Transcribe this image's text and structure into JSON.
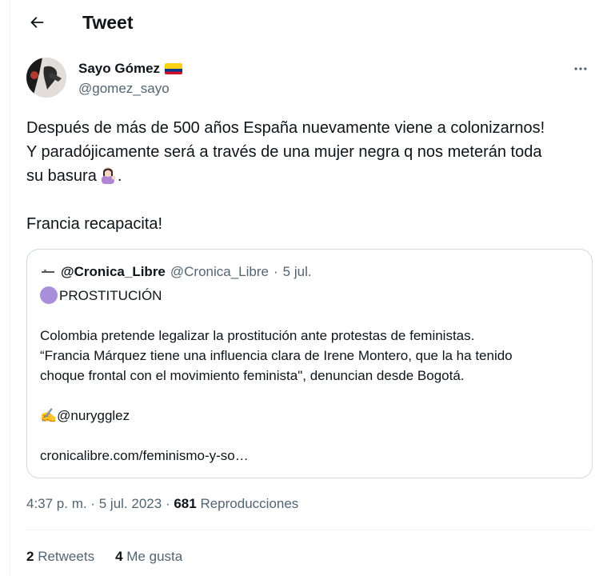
{
  "header": {
    "title": "Tweet"
  },
  "author": {
    "name": "Sayo Gómez",
    "handle": "@gomez_sayo"
  },
  "tweet": {
    "line1": "Después de más de 500 años España nuevamente viene a colonizarnos!",
    "line2": "Y paradójicamente será a través de una mujer negra q nos meterán toda",
    "line3_prefix": "su basura",
    "line3_suffix": ".",
    "line4": "Francia recapacita!"
  },
  "quote": {
    "name": "@Cronica_Libre",
    "handle": "@Cronica_Libre",
    "sep": "·",
    "date": "5 jul.",
    "line1_text": "PROSTITUCIÓN",
    "line2": "Colombia pretende legalizar la prostitución ante protestas de feministas.",
    "line3": "“Francia Márquez tiene una influencia clara de Irene Montero, que la ha tenido",
    "line4": "choque frontal con el movimiento feminista\", denuncian desde Bogotá.",
    "line5_emoji": "✍️",
    "line5_text": "@nurygglez",
    "link": "cronicalibre.com/feminismo-y-so…"
  },
  "timestamp": {
    "time": "4:37 p. m.",
    "sep1": "·",
    "date": "5 jul. 2023",
    "sep2": "·",
    "views": "681",
    "views_label": "Reproducciones"
  },
  "stats": {
    "retweets_count": "2",
    "retweets_label": "Retweets",
    "likes_count": "4",
    "likes_label": "Me gusta"
  },
  "colors": {
    "text": "#0f1419",
    "secondary": "#536471",
    "border": "#cfd9de",
    "quote_dot": "#a98fd9"
  }
}
